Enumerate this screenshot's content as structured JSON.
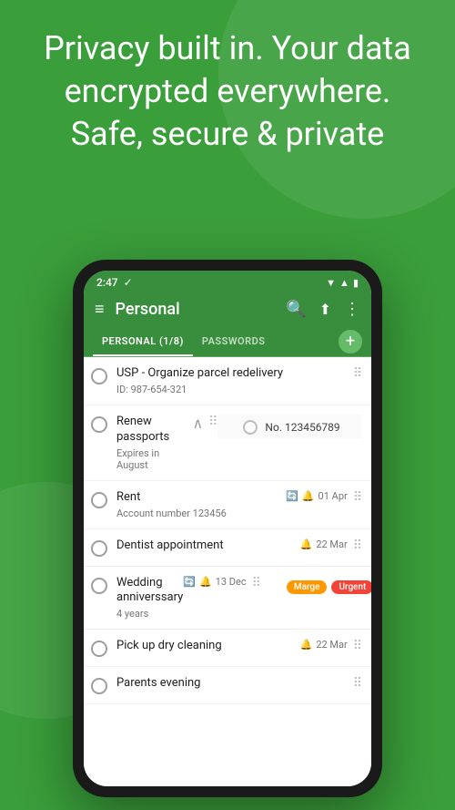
{
  "hero": {
    "text": "Privacy built in. Your data encrypted everywhere. Safe, secure & private"
  },
  "status_bar": {
    "time": "2:47",
    "check": "✓"
  },
  "toolbar": {
    "title": "Personal",
    "menu_icon": "≡",
    "search_icon": "🔍",
    "share_icon": "⬆",
    "more_icon": "⋮"
  },
  "tabs": [
    {
      "label": "PERSONAL (1/8)",
      "active": true
    },
    {
      "label": "PASSWORDS",
      "active": false
    }
  ],
  "tab_add_label": "+",
  "tasks": [
    {
      "id": "task-1",
      "title": "USP - Organize parcel redelivery",
      "subtitle": "ID: 987-654-321",
      "has_date": false,
      "has_recurring": false,
      "has_sub": false,
      "tags": []
    },
    {
      "id": "task-2",
      "title": "Renew passports",
      "subtitle": "Expires in August",
      "has_date": false,
      "has_recurring": false,
      "has_sub": true,
      "sub_item": "No. 123456789",
      "tags": []
    },
    {
      "id": "task-3",
      "title": "Rent",
      "subtitle": "Account number 123456",
      "has_date": true,
      "date": "01 Apr",
      "has_recurring": true,
      "has_bell": true,
      "has_sub": false,
      "tags": []
    },
    {
      "id": "task-4",
      "title": "Dentist appointment",
      "subtitle": "",
      "has_date": true,
      "date": "22 Mar",
      "has_recurring": false,
      "has_bell": true,
      "has_sub": false,
      "tags": []
    },
    {
      "id": "task-5",
      "title": "Wedding anniverssary",
      "subtitle": "4 years",
      "has_date": true,
      "date": "13 Dec",
      "has_recurring": true,
      "has_bell": true,
      "has_sub": false,
      "tags": [
        "Marge",
        "Urgent"
      ]
    },
    {
      "id": "task-6",
      "title": "Pick up dry cleaning",
      "subtitle": "",
      "has_date": true,
      "date": "22 Mar",
      "has_recurring": false,
      "has_bell": true,
      "has_sub": false,
      "tags": []
    },
    {
      "id": "task-7",
      "title": "Parents evening",
      "subtitle": "",
      "has_date": false,
      "has_recurring": false,
      "has_sub": false,
      "tags": []
    }
  ],
  "colors": {
    "green_dark": "#388e3c",
    "green_main": "#3a9e3a",
    "green_light": "#66bb6a",
    "orange": "#ff9800",
    "red": "#f44336"
  }
}
